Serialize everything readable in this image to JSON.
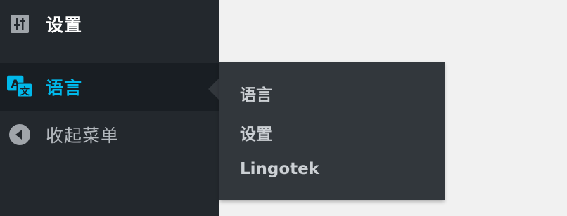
{
  "sidebar": {
    "items": [
      {
        "label": "设置",
        "icon": "sliders-icon"
      },
      {
        "label": "语言",
        "icon": "translate-icon",
        "active": true
      },
      {
        "label": "收起菜单",
        "icon": "collapse-arrow-icon"
      }
    ]
  },
  "flyout": {
    "items": [
      {
        "label": "语言"
      },
      {
        "label": "设置"
      },
      {
        "label": "Lingotek"
      }
    ]
  },
  "colors": {
    "sidebar_bg": "#23282d",
    "active_bg": "#191e23",
    "accent": "#00b9eb",
    "flyout_bg": "#32373c",
    "page_bg": "#f1f1f1"
  }
}
